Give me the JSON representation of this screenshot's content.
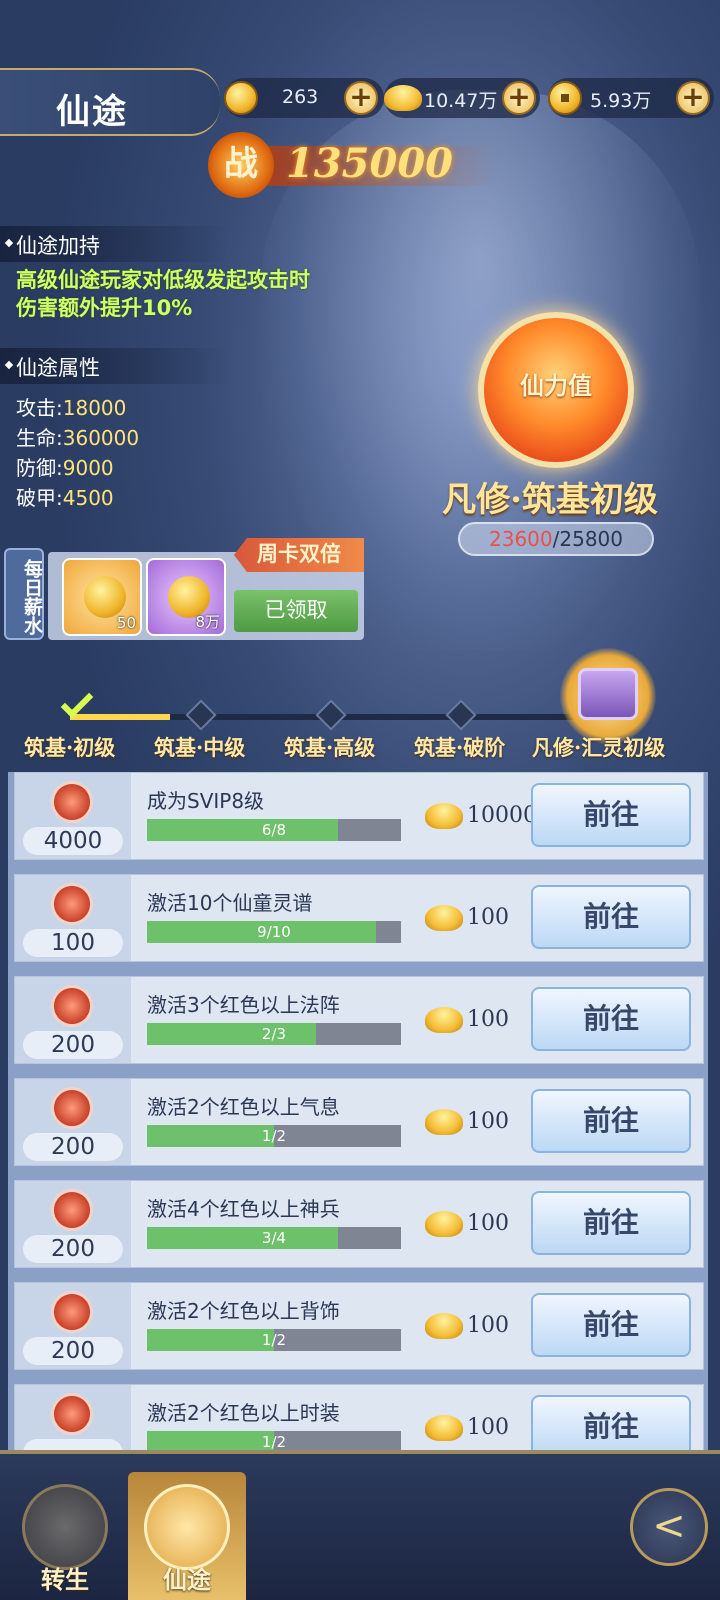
{
  "header": {
    "title": "仙途",
    "resources": [
      {
        "icon": "gold-coin-icon",
        "value": "263"
      },
      {
        "icon": "gold-ingot-icon",
        "value": "10.47万"
      },
      {
        "icon": "copper-coin-icon",
        "value": "5.93万"
      }
    ],
    "plus_label": "+"
  },
  "power": {
    "badge": "战",
    "value": "135000"
  },
  "bonus": {
    "heading": "仙途加持",
    "line1": "高级仙途玩家对低级发起攻击时",
    "line2": "伤害额外提升10%"
  },
  "attributes": {
    "heading": "仙途属性",
    "items": [
      {
        "label": "攻击:",
        "value": "18000"
      },
      {
        "label": "生命:",
        "value": "360000"
      },
      {
        "label": "防御:",
        "value": "9000"
      },
      {
        "label": "破甲:",
        "value": "4500"
      }
    ]
  },
  "orb": {
    "label": "仙力值",
    "realm": "凡修·筑基初级",
    "current": "23600",
    "max": "/25800"
  },
  "daily": {
    "label": "每日薪水",
    "tag": "周卡双倍",
    "items": [
      {
        "count": "50"
      },
      {
        "count": "8万"
      }
    ],
    "claimed": "已领取"
  },
  "stages": [
    "筑基·初级",
    "筑基·中级",
    "筑基·高级",
    "筑基·破阶",
    "凡修·汇灵初级"
  ],
  "tasks": [
    {
      "points": "4000",
      "name": "成为SVIP8级",
      "progress": "6/8",
      "fraction": 0.75,
      "reward": "10000",
      "button": "前往"
    },
    {
      "points": "100",
      "name": "激活10个仙童灵谱",
      "progress": "9/10",
      "fraction": 0.9,
      "reward": "100",
      "button": "前往"
    },
    {
      "points": "200",
      "name": "激活3个红色以上法阵",
      "progress": "2/3",
      "fraction": 0.6667,
      "reward": "100",
      "button": "前往"
    },
    {
      "points": "200",
      "name": "激活2个红色以上气息",
      "progress": "1/2",
      "fraction": 0.5,
      "reward": "100",
      "button": "前往"
    },
    {
      "points": "200",
      "name": "激活4个红色以上神兵",
      "progress": "3/4",
      "fraction": 0.75,
      "reward": "100",
      "button": "前往"
    },
    {
      "points": "200",
      "name": "激活2个红色以上背饰",
      "progress": "1/2",
      "fraction": 0.5,
      "reward": "100",
      "button": "前往"
    },
    {
      "points": "",
      "name": "激活2个红色以上时装",
      "progress": "1/2",
      "fraction": 0.5,
      "reward": "100",
      "button": "前往"
    }
  ],
  "nav": {
    "tab1": "转生",
    "tab2": "仙途",
    "back": "<"
  }
}
